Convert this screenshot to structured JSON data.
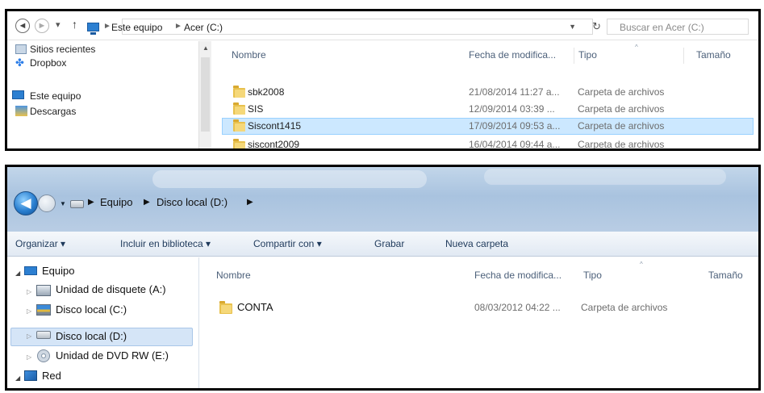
{
  "top_window": {
    "nav": {
      "back": "◄",
      "forward": "►",
      "dropdown": "▾",
      "up": "↑"
    },
    "breadcrumb": [
      "Este equipo",
      "Acer (C:)"
    ],
    "search_placeholder": "Buscar en Acer (C:)",
    "sidebar": [
      "Sitios recientes",
      "Dropbox",
      "Este equipo",
      "Descargas"
    ],
    "columns": {
      "name": "Nombre",
      "date": "Fecha de modifica...",
      "type": "Tipo",
      "size": "Tamaño"
    },
    "rows": [
      {
        "name": "sbk2008",
        "date": "21/08/2014 11:27 a...",
        "type": "Carpeta de archivos"
      },
      {
        "name": "SIS",
        "date": "12/09/2014 03:39 ...",
        "type": "Carpeta de archivos"
      },
      {
        "name": "Siscont1415",
        "date": "17/09/2014 09:53 a...",
        "type": "Carpeta de archivos",
        "selected": true
      },
      {
        "name": "siscont2009",
        "date": "16/04/2014 09:44 a...",
        "type": "Carpeta de archivos"
      }
    ]
  },
  "bottom_window": {
    "breadcrumb": [
      "Equipo",
      "Disco local (D:)"
    ],
    "toolbar": [
      "Organizar ▾",
      "Incluir en biblioteca ▾",
      "Compartir con ▾",
      "Grabar",
      "Nueva carpeta"
    ],
    "sidebar": [
      "Equipo",
      "Unidad de disquete (A:)",
      "Disco local (C:)",
      "Disco local (D:)",
      "Unidad de DVD RW (E:)",
      "Red"
    ],
    "columns": {
      "name": "Nombre",
      "date": "Fecha de modifica...",
      "type": "Tipo",
      "size": "Tamaño"
    },
    "rows": [
      {
        "name": "CONTA",
        "date": "08/03/2012 04:22 ...",
        "type": "Carpeta de archivos"
      }
    ]
  }
}
